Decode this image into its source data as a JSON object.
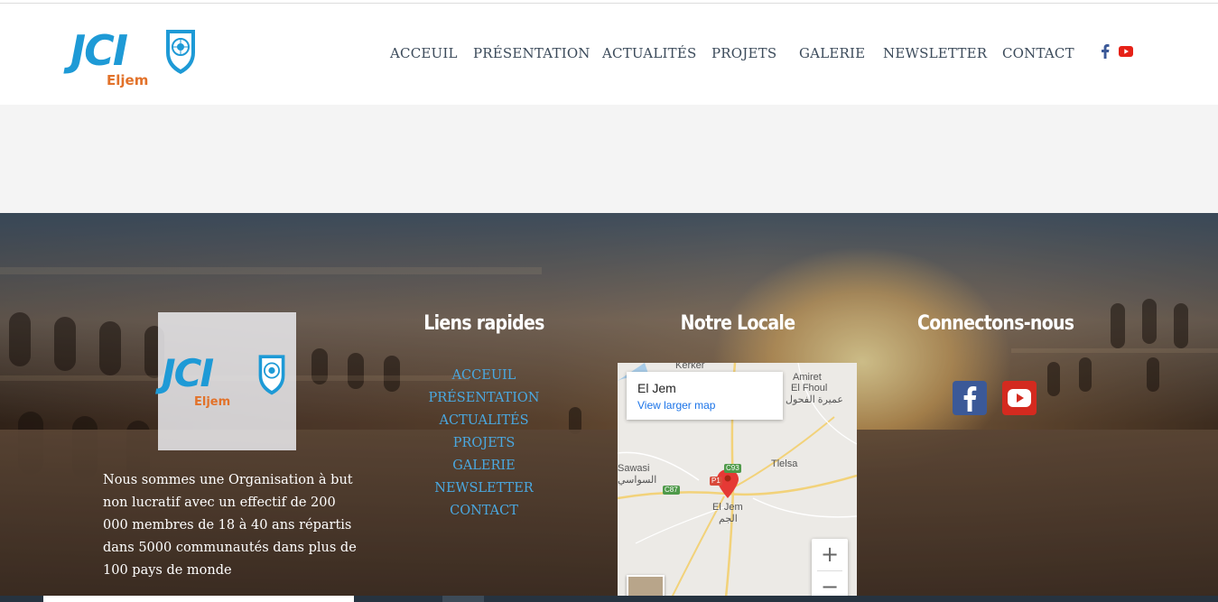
{
  "brand": {
    "logo_text": "JCI",
    "logo_sub": "Eljem",
    "primary_color": "#1e9ad6",
    "accent_color": "#e2722a"
  },
  "nav": {
    "items": [
      {
        "label": "ACCEUIL"
      },
      {
        "label": "PRÉSENTATION"
      },
      {
        "label": "ACTUALITÉS"
      },
      {
        "label": "PROJETS"
      },
      {
        "label": "GALERIE"
      },
      {
        "label": "NEWSLETTER"
      },
      {
        "label": "CONTACT"
      }
    ],
    "social": [
      {
        "icon": "facebook-icon",
        "color": "#3b5998"
      },
      {
        "icon": "youtube-icon",
        "color": "#e62117"
      }
    ]
  },
  "footer": {
    "about_text": "Nous sommes une Organisation à but non lucratif avec un effectif de 200 000 membres de 18 à 40 ans répartis dans 5000 communautés dans plus de 100 pays de monde",
    "links_title": "Liens rapides",
    "links": [
      {
        "label": "ACCEUIL"
      },
      {
        "label": "PRÉSENTATION"
      },
      {
        "label": "ACTUALITÉS"
      },
      {
        "label": "PROJETS"
      },
      {
        "label": "GALERIE"
      },
      {
        "label": "NEWSLETTER"
      },
      {
        "label": "CONTACT"
      }
    ],
    "link_color": "#4aa8e0",
    "location_title": "Notre Locale",
    "map": {
      "place_name": "El Jem",
      "larger_map_link": "View larger map",
      "labels": {
        "kerker": "Kerker",
        "amiret": "Amiret",
        "el_fhoul": "El Fhoul",
        "amiret_ar": "عميرة الفحول",
        "sawasi": "Sawasi",
        "sawasi_ar": "السواسي",
        "tlelsa": "Tlelsa",
        "el_jem_city": "El Jem",
        "el_jem_ar": "الجم",
        "road_p1": "P1",
        "road_c93": "C93",
        "road_c87": "C87"
      },
      "zoom_in": "+",
      "zoom_out": "−"
    },
    "connect_title": "Connectons-nous",
    "social": [
      {
        "icon": "facebook-icon",
        "color": "#3b5998"
      },
      {
        "icon": "youtube-icon",
        "color": "#d42a1f"
      }
    ]
  }
}
